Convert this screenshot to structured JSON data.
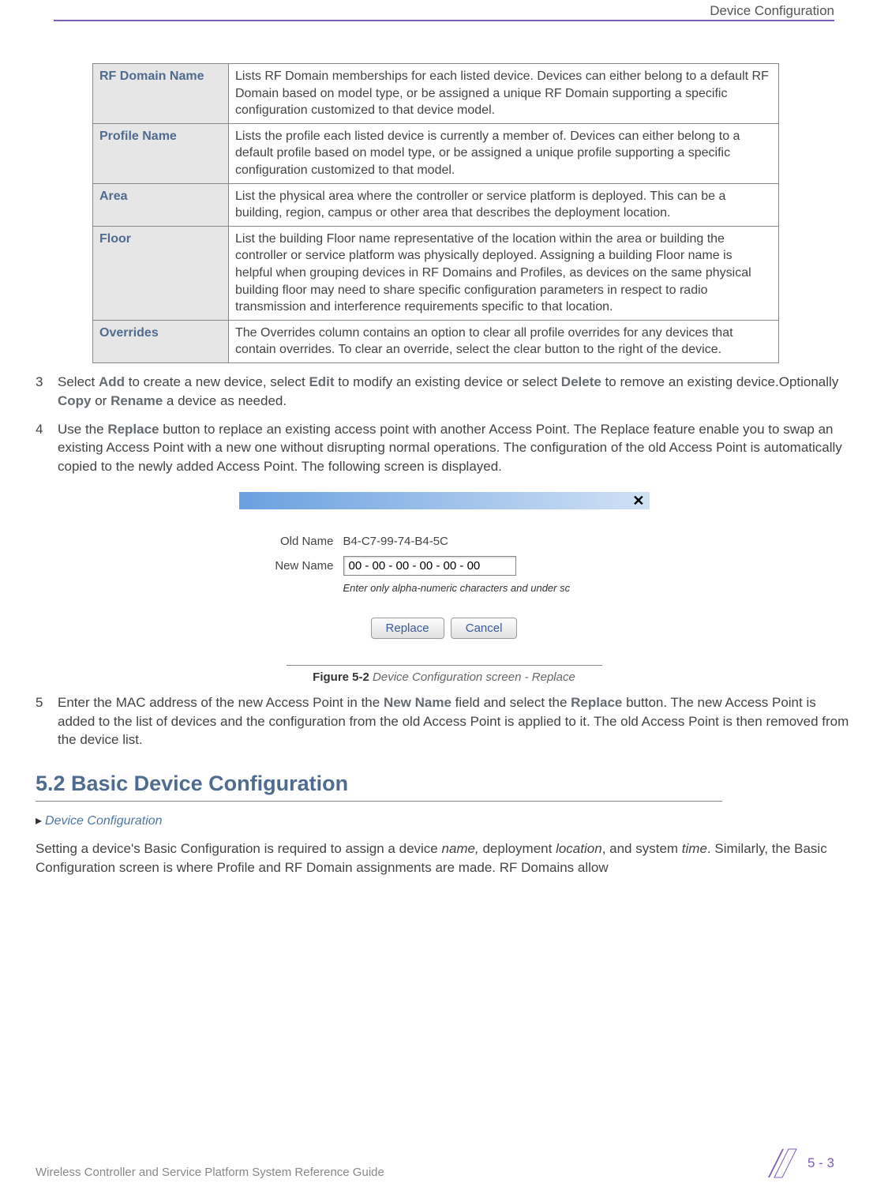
{
  "header": {
    "title": "Device Configuration"
  },
  "table": {
    "rows": [
      {
        "term": "RF Domain Name",
        "desc": "Lists RF Domain memberships for each listed device. Devices can either belong to a default RF Domain based on model type, or be assigned a unique RF Domain supporting a specific configuration customized to that device model."
      },
      {
        "term": "Profile Name",
        "desc": "Lists the profile each listed device is currently a member of. Devices can either belong to a default profile based on model type, or be assigned a unique profile supporting a specific configuration customized to that model."
      },
      {
        "term": "Area",
        "desc": "List the physical area where the controller or service platform is deployed. This can be a building, region, campus or other area that describes the deployment location."
      },
      {
        "term": "Floor",
        "desc": "List the building Floor name representative of the location within the area or building the controller or service platform was physically deployed. Assigning a building Floor name is helpful when grouping devices in RF Domains and Profiles, as devices on the same physical building floor may need to share specific configuration parameters in respect to radio transmission and interference requirements specific to that location."
      },
      {
        "term": "Overrides",
        "desc": "The Overrides column contains an option to clear all profile overrides for any devices that contain overrides. To clear an override, select the clear button to the right of the device."
      }
    ]
  },
  "steps": {
    "s3": {
      "num": "3",
      "prefix": "Select ",
      "add": "Add",
      "mid1": " to create a new device, select ",
      "edit": "Edit",
      "mid2": " to modify an existing device or select ",
      "delete": "Delete",
      "mid3": " to remove an existing device.Optionally ",
      "copy": "Copy",
      "mid4": " or ",
      "rename": "Rename",
      "mid5": " a device as needed."
    },
    "s4": {
      "num": "4",
      "prefix": "Use the ",
      "replace": "Replace",
      "rest": " button to replace an existing access point with another Access Point. The Replace feature enable you to swap an existing Access Point with a new one without disrupting normal operations. The configuration of the old Access Point is automatically copied to the newly added Access Point. The following screen is displayed."
    },
    "s5": {
      "num": "5",
      "prefix": "Enter the MAC address of the new Access Point in the ",
      "newname": "New Name",
      "mid": " field and select the ",
      "replace": "Replace",
      "rest": " button. The new Access Point is added to the list of devices and the configuration from the old Access Point is applied to it. The old Access Point is then removed from the device list."
    }
  },
  "dialog": {
    "old_name_label": "Old Name",
    "old_name_value": "B4-C7-99-74-B4-5C",
    "new_name_label": "New Name",
    "new_name_value": "00 - 00 - 00 - 00 - 00 - 00",
    "hint": "Enter only alpha-numeric characters and under sc",
    "replace_btn": "Replace",
    "cancel_btn": "Cancel"
  },
  "figure": {
    "label": "Figure 5-2",
    "desc": " Device Configuration screen - Replace"
  },
  "section": {
    "heading": "5.2 Basic Device Configuration",
    "breadcrumb": "Device Configuration",
    "para_pre": "Setting a device's Basic Configuration is required to assign a device ",
    "i1": "name,",
    "para_mid1": " deployment ",
    "i2": "location",
    "para_mid2": ", and system ",
    "i3": "time",
    "para_rest": ". Similarly, the Basic Configuration screen is where Profile and RF Domain assignments are made. RF Domains allow"
  },
  "footer": {
    "left": "Wireless Controller and Service Platform System Reference Guide",
    "page": "5 - 3"
  }
}
